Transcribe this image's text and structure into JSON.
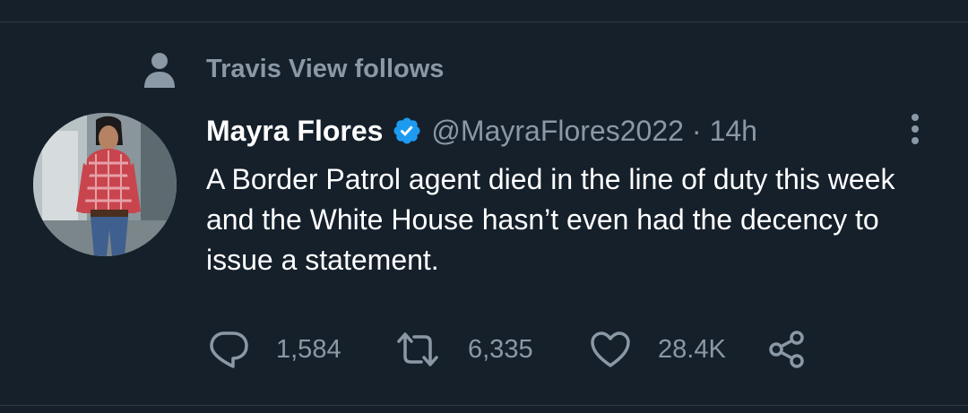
{
  "social_context": {
    "text": "Travis View follows",
    "icon": "person-icon"
  },
  "tweet": {
    "author_name": "Mayra Flores",
    "verified": true,
    "handle": "@MayraFlores2022",
    "separator": "·",
    "timestamp": "14h",
    "text": "A Border Patrol agent died in the line of duty this week and the White House hasn’t even had the decency to issue a statement.",
    "avatar_description": "profile photo"
  },
  "actions": {
    "reply_count": "1,584",
    "retweet_count": "6,335",
    "like_count": "28.4K",
    "reply_icon": "reply-icon",
    "retweet_icon": "retweet-icon",
    "like_icon": "heart-icon",
    "share_icon": "share-icon"
  },
  "colors": {
    "background": "#15202b",
    "primary_text": "#ffffff",
    "secondary_text": "#8b98a5",
    "verified_blue": "#1d9bf0",
    "divider": "#2f3b47"
  }
}
